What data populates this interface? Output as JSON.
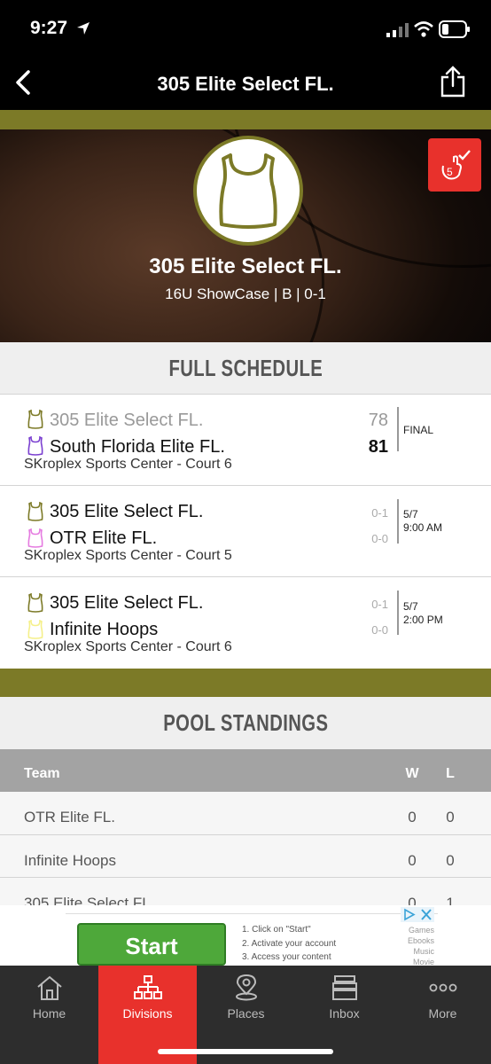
{
  "status_bar": {
    "time": "9:27"
  },
  "nav": {
    "title": "305 Elite  Select FL."
  },
  "hero": {
    "team_name": "305 Elite  Select FL.",
    "subtitle": "16U ShowCase | B | 0-1",
    "badge_number": "5"
  },
  "schedule": {
    "title": "FULL SCHEDULE",
    "games": [
      {
        "team1": "305 Elite  Select FL.",
        "team1_value": "78",
        "team2": "South Florida Elite FL.",
        "team2_value": "81",
        "venue": "SKroplex Sports Center - Court 6",
        "meta_line1": "FINAL",
        "meta_line2": "",
        "team2_color": "#7a3fd0"
      },
      {
        "team1": "305 Elite  Select FL.",
        "team1_value": "0-1",
        "team2": "OTR Elite FL.",
        "team2_value": "0-0",
        "venue": "SKroplex Sports Center - Court 5",
        "meta_line1": "5/7",
        "meta_line2": "9:00 AM",
        "team2_color": "#e57be0"
      },
      {
        "team1": "305 Elite  Select FL.",
        "team1_value": "0-1",
        "team2": "Infinite Hoops",
        "team2_value": "0-0",
        "venue": "SKroplex Sports Center - Court 6",
        "meta_line1": "5/7",
        "meta_line2": "2:00 PM",
        "team2_color": "#f5f08a"
      }
    ]
  },
  "standings": {
    "title": "POOL STANDINGS",
    "columns": {
      "team": "Team",
      "w": "W",
      "l": "L"
    },
    "rows": [
      {
        "team": "OTR Elite FL.",
        "w": "0",
        "l": "0"
      },
      {
        "team": "Infinite Hoops",
        "w": "0",
        "l": "0"
      },
      {
        "team": "305 Elite  Select FL",
        "w": "0",
        "l": "1"
      }
    ]
  },
  "ad": {
    "button": "Start",
    "steps": [
      "1. Click on \"Start\"",
      "2. Activate your account",
      "3. Access your content"
    ],
    "categories": [
      "Games",
      "Ebooks",
      "Music",
      "Movie"
    ]
  },
  "tabs": [
    {
      "label": "Home",
      "icon": "home-icon"
    },
    {
      "label": "Divisions",
      "icon": "divisions-icon"
    },
    {
      "label": "Places",
      "icon": "places-icon"
    },
    {
      "label": "Inbox",
      "icon": "inbox-icon"
    },
    {
      "label": "More",
      "icon": "more-icon"
    }
  ],
  "colors": {
    "accent": "#e8312c",
    "olive": "#7c7a27",
    "tabbar": "#2d2d2d"
  }
}
